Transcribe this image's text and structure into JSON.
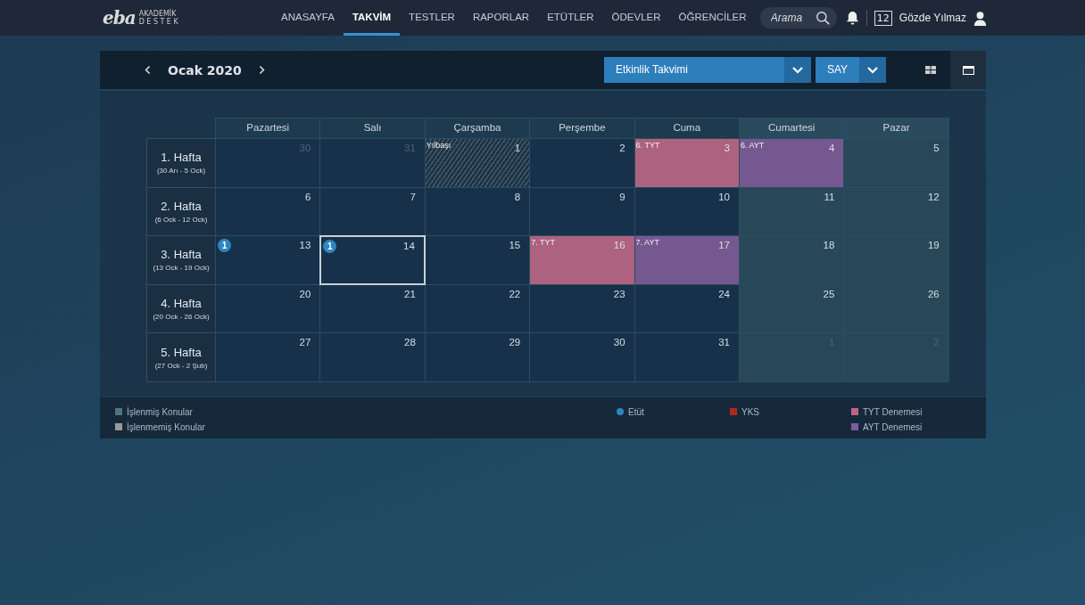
{
  "logo": {
    "mark": "eba",
    "line1": "AKADEMİK",
    "line2": "DESTEK"
  },
  "nav": [
    {
      "label": "ANASAYFA",
      "selected": false
    },
    {
      "label": "TAKVİM",
      "selected": true
    },
    {
      "label": "TESTLER",
      "selected": false
    },
    {
      "label": "RAPORLAR",
      "selected": false
    },
    {
      "label": "ETÜTLER",
      "selected": false
    },
    {
      "label": "ÖDEVLER",
      "selected": false
    },
    {
      "label": "ÖĞRENCİLER",
      "selected": false
    }
  ],
  "search": {
    "placeholder": "Arama"
  },
  "user": {
    "grade": "12",
    "name": "Gözde Yılmaz"
  },
  "toolbar": {
    "month": "Ocak 2020",
    "calendar_select": "Etkinlik Takvimi",
    "field_select": "SAY",
    "view_modes": [
      {
        "kind": "grid",
        "selected": false
      },
      {
        "kind": "single",
        "selected": true
      }
    ]
  },
  "calendar": {
    "days": [
      "Pazartesi",
      "Salı",
      "Çarşamba",
      "Perşembe",
      "Cuma",
      "Cumartesi",
      "Pazar"
    ],
    "weeks": [
      {
        "title": "1. Hafta",
        "range": "(30 Arı - 5 Ock)",
        "cells": [
          {
            "day": "30",
            "muted": true,
            "selected": false
          },
          {
            "day": "31",
            "muted": true,
            "selected": false
          },
          {
            "day": "1",
            "muted": false,
            "selected": false,
            "event": {
              "kind": "holiday",
              "label": "Yılbaşı"
            }
          },
          {
            "day": "2",
            "muted": false,
            "selected": false
          },
          {
            "day": "3",
            "muted": false,
            "selected": false,
            "event": {
              "kind": "tyt",
              "label": "6. TYT"
            }
          },
          {
            "day": "4",
            "muted": false,
            "selected": false,
            "event": {
              "kind": "ayt",
              "label": "6. AYT"
            }
          },
          {
            "day": "5",
            "muted": false,
            "selected": false
          }
        ]
      },
      {
        "title": "2. Hafta",
        "range": "(6 Ock - 12 Ock)",
        "cells": [
          {
            "day": "6",
            "muted": false,
            "selected": false
          },
          {
            "day": "7",
            "muted": false,
            "selected": false
          },
          {
            "day": "8",
            "muted": false,
            "selected": false
          },
          {
            "day": "9",
            "muted": false,
            "selected": false
          },
          {
            "day": "10",
            "muted": false,
            "selected": false
          },
          {
            "day": "11",
            "muted": false,
            "selected": false
          },
          {
            "day": "12",
            "muted": false,
            "selected": false
          }
        ]
      },
      {
        "title": "3. Hafta",
        "range": "(13 Ock - 19 Ock)",
        "cells": [
          {
            "day": "13",
            "muted": false,
            "selected": false,
            "badge": "1"
          },
          {
            "day": "14",
            "muted": false,
            "selected": true,
            "badge": "1"
          },
          {
            "day": "15",
            "muted": false,
            "selected": false
          },
          {
            "day": "16",
            "muted": false,
            "selected": false,
            "event": {
              "kind": "tyt",
              "label": "7. TYT"
            }
          },
          {
            "day": "17",
            "muted": false,
            "selected": false,
            "event": {
              "kind": "ayt",
              "label": "7. AYT"
            }
          },
          {
            "day": "18",
            "muted": false,
            "selected": false
          },
          {
            "day": "19",
            "muted": false,
            "selected": false
          }
        ]
      },
      {
        "title": "4. Hafta",
        "range": "(20 Ock - 26 Ock)",
        "cells": [
          {
            "day": "20",
            "muted": false,
            "selected": false
          },
          {
            "day": "21",
            "muted": false,
            "selected": false
          },
          {
            "day": "22",
            "muted": false,
            "selected": false
          },
          {
            "day": "23",
            "muted": false,
            "selected": false
          },
          {
            "day": "24",
            "muted": false,
            "selected": false
          },
          {
            "day": "25",
            "muted": false,
            "selected": false
          },
          {
            "day": "26",
            "muted": false,
            "selected": false
          }
        ]
      },
      {
        "title": "5. Hafta",
        "range": "(27 Ock - 2 Şub)",
        "cells": [
          {
            "day": "27",
            "muted": false,
            "selected": false
          },
          {
            "day": "28",
            "muted": false,
            "selected": false
          },
          {
            "day": "29",
            "muted": false,
            "selected": false
          },
          {
            "day": "30",
            "muted": false,
            "selected": false
          },
          {
            "day": "31",
            "muted": false,
            "selected": false
          },
          {
            "day": "1",
            "muted": true,
            "selected": false
          },
          {
            "day": "2",
            "muted": true,
            "selected": false
          }
        ]
      }
    ]
  },
  "legend": [
    [
      {
        "kind": "square",
        "color": "#4f7288",
        "label": "İşlenmiş Konular"
      },
      {
        "kind": "square",
        "color": "#9a9a9a",
        "label": "İşlenmemiş Konular"
      }
    ],
    [
      {
        "kind": "dot",
        "color": "#2e86c1",
        "label": "Etüt"
      }
    ],
    [
      {
        "kind": "square",
        "color": "#b3261e",
        "label": "YKS"
      }
    ],
    [
      {
        "kind": "square",
        "color": "#c06384",
        "label": "TYT Denemesi"
      },
      {
        "kind": "square",
        "color": "#7e5c9e",
        "label": "AYT Denemesi"
      }
    ]
  ]
}
